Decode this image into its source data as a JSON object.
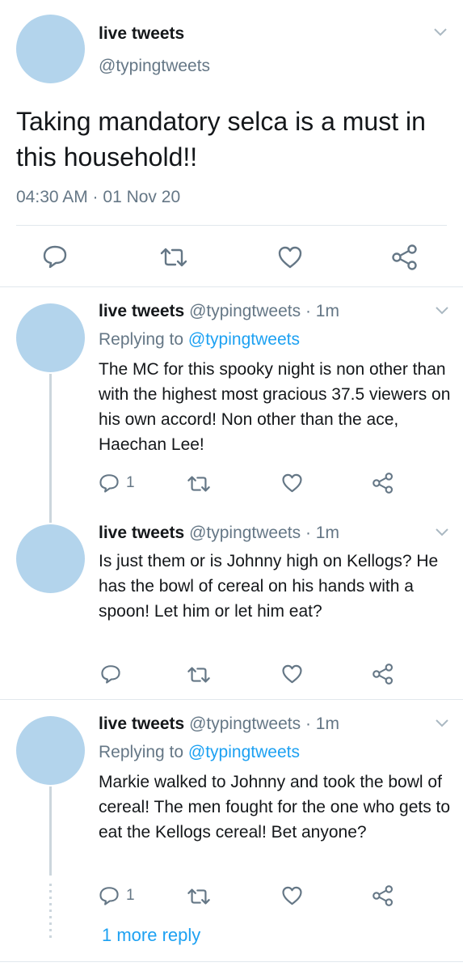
{
  "main_tweet": {
    "name": "live tweets",
    "handle": "@typingtweets",
    "text": "Taking mandatory selca is a must in this household!!",
    "timestamp": "04:30 AM · 01 Nov 20"
  },
  "replies": [
    {
      "name": "live tweets",
      "meta": "@typingtweets · 1m",
      "replying_prefix": "Replying to",
      "replying_handle": "@typingtweets",
      "text": "The MC for this spooky night is non other than with the highest most gracious 37.5 viewers on his own accord!  Non other than the ace, Haechan Lee!",
      "reply_count": "1"
    },
    {
      "name": "live tweets",
      "meta": "@typingtweets · 1m",
      "text": "Is just them or is Johnny high on Kellogs? He has the bowl of cereal on his hands with a spoon! Let him or let him eat?"
    },
    {
      "name": "live tweets",
      "meta": "@typingtweets · 1m",
      "replying_prefix": "Replying to",
      "replying_handle": "@typingtweets",
      "text": "Markie walked to Johnny and took the bowl of cereal! The men fought for the one who gets to eat the Kellogs cereal! Bet anyone?",
      "reply_count": "1"
    }
  ],
  "more_replies_label": "1 more reply",
  "colors": {
    "accent": "#1da1f2",
    "muted": "#657786",
    "avatar": "#b3d4ec",
    "divider": "#e1e8ed"
  },
  "icons": [
    "reply-icon",
    "retweet-icon",
    "like-icon",
    "share-icon",
    "chevron-down-icon"
  ]
}
